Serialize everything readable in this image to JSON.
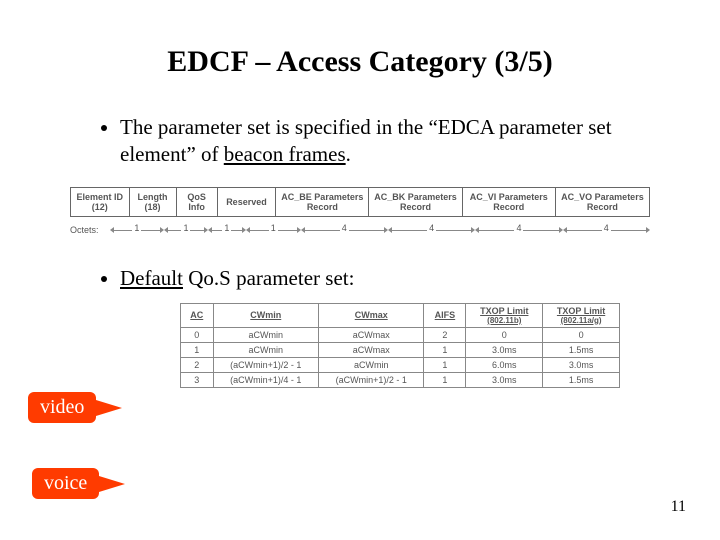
{
  "title": "EDCF – Access Category (3/5)",
  "bullet1_a": "The parameter set is specified in the “EDCA parameter set element” of ",
  "bullet1_b_underlined": "beacon frames",
  "bullet1_c": ".",
  "bullet2_a_underlined": "Default",
  "bullet2_b": " Qo.S parameter set:",
  "page_number": "11",
  "callout_video": "video",
  "callout_voice": "voice",
  "fields": {
    "f0": "Element ID (12)",
    "f1": "Length (18)",
    "f2": "QoS Info",
    "f3": "Reserved",
    "f4": "AC_BE Parameters Record",
    "f5": "AC_BK Parameters Record",
    "f6": "AC_VI Parameters Record",
    "f7": "AC_VO Parameters Record"
  },
  "octets_label": "Octets:",
  "octets": {
    "o0": "1",
    "o1": "1",
    "o2": "1",
    "o3": "1",
    "o4": "4",
    "o5": "4",
    "o6": "4",
    "o7": "4"
  },
  "headers": {
    "h0": "AC",
    "h1": "CWmin",
    "h2": "CWmax",
    "h3": "AIFS",
    "h4a": "TXOP Limit",
    "h4b": "(802.11b)",
    "h5a": "TXOP Limit",
    "h5b": "(802.11a/g)"
  },
  "chart_data": {
    "type": "table",
    "columns": [
      "AC",
      "CWmin",
      "CWmax",
      "AIFS",
      "TXOP Limit (802.11b)",
      "TXOP Limit (802.11a/g)"
    ],
    "rows": [
      {
        "AC": "0",
        "CWmin": "aCWmin",
        "CWmax": "aCWmax",
        "AIFS": "2",
        "TXOPb": "0",
        "TXOPag": "0"
      },
      {
        "AC": "1",
        "CWmin": "aCWmin",
        "CWmax": "aCWmax",
        "AIFS": "1",
        "TXOPb": "3.0ms",
        "TXOPag": "1.5ms"
      },
      {
        "AC": "2",
        "CWmin": "(aCWmin+1)/2 - 1",
        "CWmax": "aCWmin",
        "AIFS": "1",
        "TXOPb": "6.0ms",
        "TXOPag": "3.0ms"
      },
      {
        "AC": "3",
        "CWmin": "(aCWmin+1)/4 - 1",
        "CWmax": "(aCWmin+1)/2 - 1",
        "AIFS": "1",
        "TXOPb": "3.0ms",
        "TXOPag": "1.5ms"
      }
    ]
  }
}
